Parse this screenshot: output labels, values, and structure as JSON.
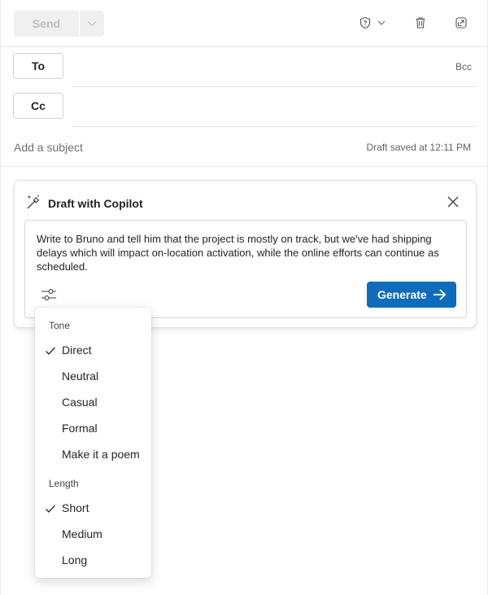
{
  "toolbar": {
    "send_label": "Send",
    "send_options_icon": "chevron-down-icon",
    "sensitivity_icon": "shield-question-icon",
    "sensitivity_dropdown_icon": "chevron-down-icon",
    "delete_icon": "trash-icon",
    "popout_icon": "popout-icon"
  },
  "recipients": {
    "to_label": "To",
    "cc_label": "Cc",
    "bcc_label": "Bcc"
  },
  "subject": {
    "placeholder": "Add a subject",
    "status": "Draft saved at 12:11 PM"
  },
  "copilot": {
    "title": "Draft with Copilot",
    "icon": "magic-wand-icon",
    "prompt": "Write to Bruno and tell him that the project is mostly on track, but we've had shipping delays which will impact on-location activation, while the online efforts can continue as scheduled.",
    "generate_label": "Generate",
    "accent": "#0f6cbd"
  },
  "menu": {
    "tone_header": "Tone",
    "tone_options": [
      "Direct",
      "Neutral",
      "Casual",
      "Formal",
      "Make it a poem"
    ],
    "tone_selected": "Direct",
    "length_header": "Length",
    "length_options": [
      "Short",
      "Medium",
      "Long"
    ],
    "length_selected": "Short"
  }
}
